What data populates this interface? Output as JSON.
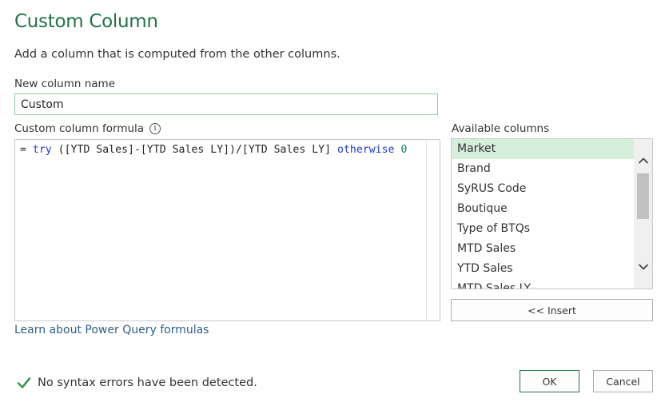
{
  "dialog": {
    "title": "Custom Column",
    "subtitle": "Add a column that is computed from the other columns."
  },
  "name_field": {
    "label": "New column name",
    "value": "Custom"
  },
  "formula": {
    "label": "Custom column formula",
    "info_icon_text": "i",
    "tokens": {
      "prefix": "= ",
      "kw_try": "try",
      "expr": " ([YTD Sales]-[YTD Sales LY])/[YTD Sales LY] ",
      "kw_otherwise": "otherwise",
      "space": " ",
      "num": "0"
    }
  },
  "learn_link": "Learn about Power Query formulas",
  "status": {
    "text": "No syntax errors have been detected."
  },
  "available_columns": {
    "label": "Available columns",
    "items": [
      "Market",
      "Brand",
      "SyRUS Code",
      "Boutique",
      "Type of BTQs",
      "MTD Sales",
      "YTD Sales",
      "MTD Sales LY"
    ],
    "selected_index": 0
  },
  "buttons": {
    "insert": "<< Insert",
    "ok": "OK",
    "cancel": "Cancel"
  },
  "colors": {
    "accent": "#217346",
    "selection": "#d6eedc",
    "keyword": "#1f3cc4",
    "number": "#098658",
    "link": "#2e5f8a"
  },
  "icons": [
    "info-icon",
    "checkmark-icon",
    "chevron-up-icon",
    "chevron-down-icon"
  ]
}
